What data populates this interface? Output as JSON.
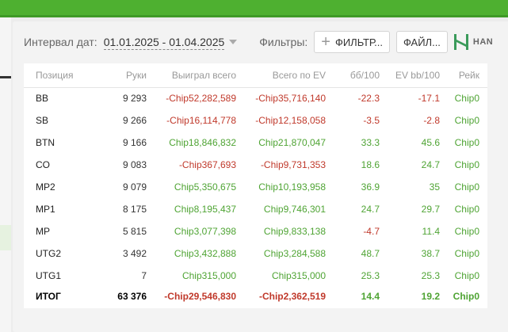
{
  "toolbar": {
    "date_label": "Интервал дат:",
    "date_range": "01.01.2025 - 01.04.2025",
    "filters_label": "Фильтры:",
    "filter_button": "ФИЛЬТР...",
    "file_button": "ФАЙЛ...",
    "brand_text": "HAN"
  },
  "table": {
    "headers": [
      "Позиция",
      "Руки",
      "Выиграл всего",
      "Всего по EV",
      "бб/100",
      "EV bb/100",
      "Рейк"
    ],
    "rows": [
      {
        "pos": "BB",
        "hands": "9 293",
        "won": "-Chip52,282,589",
        "ev": "-Chip35,716,140",
        "bb100": "-22.3",
        "evbb100": "-17.1",
        "rake": "Chip0"
      },
      {
        "pos": "SB",
        "hands": "9 266",
        "won": "-Chip16,114,778",
        "ev": "-Chip12,158,058",
        "bb100": "-3.5",
        "evbb100": "-2.8",
        "rake": "Chip0"
      },
      {
        "pos": "BTN",
        "hands": "9 166",
        "won": "Chip18,846,832",
        "ev": "Chip21,870,047",
        "bb100": "33.3",
        "evbb100": "45.6",
        "rake": "Chip0"
      },
      {
        "pos": "CO",
        "hands": "9 083",
        "won": "-Chip367,693",
        "ev": "-Chip9,731,353",
        "bb100": "18.6",
        "evbb100": "24.7",
        "rake": "Chip0"
      },
      {
        "pos": "MP2",
        "hands": "9 079",
        "won": "Chip5,350,675",
        "ev": "Chip10,193,958",
        "bb100": "36.9",
        "evbb100": "35",
        "rake": "Chip0"
      },
      {
        "pos": "MP1",
        "hands": "8 175",
        "won": "Chip8,195,437",
        "ev": "Chip9,746,301",
        "bb100": "24.7",
        "evbb100": "29.7",
        "rake": "Chip0"
      },
      {
        "pos": "MP",
        "hands": "5 815",
        "won": "Chip3,077,398",
        "ev": "Chip9,833,138",
        "bb100": "-4.7",
        "evbb100": "11.4",
        "rake": "Chip0"
      },
      {
        "pos": "UTG2",
        "hands": "3 492",
        "won": "Chip3,432,888",
        "ev": "Chip3,284,588",
        "bb100": "48.7",
        "evbb100": "38.7",
        "rake": "Chip0"
      },
      {
        "pos": "UTG1",
        "hands": "7",
        "won": "Chip315,000",
        "ev": "Chip315,000",
        "bb100": "25.3",
        "evbb100": "25.3",
        "rake": "Chip0"
      }
    ],
    "total": {
      "pos": "ИТОГ",
      "hands": "63 376",
      "won": "-Chip29,546,830",
      "ev": "-Chip2,362,519",
      "bb100": "14.4",
      "evbb100": "19.2",
      "rake": "Chip0"
    }
  },
  "colors": {
    "accent": "#4eb030",
    "positive": "#4fa434",
    "negative": "#c0392b",
    "brand_icon": "#3a9a5a"
  },
  "icons": {
    "filter_add": "plus-icon",
    "brand": "brand-logo-icon",
    "date_dropdown": "chevron-down-icon"
  }
}
